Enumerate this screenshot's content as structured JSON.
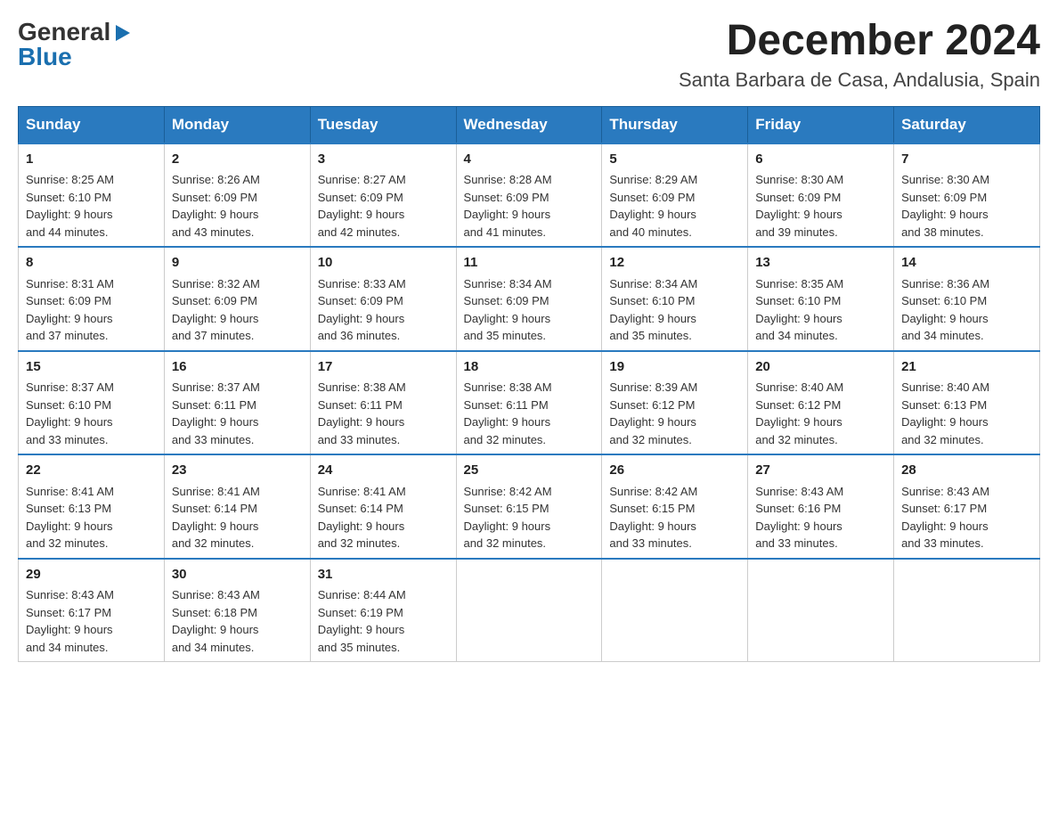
{
  "logo": {
    "general": "General",
    "blue": "Blue"
  },
  "header": {
    "month": "December 2024",
    "location": "Santa Barbara de Casa, Andalusia, Spain"
  },
  "weekdays": [
    "Sunday",
    "Monday",
    "Tuesday",
    "Wednesday",
    "Thursday",
    "Friday",
    "Saturday"
  ],
  "weeks": [
    [
      {
        "day": "1",
        "sunrise": "8:25 AM",
        "sunset": "6:10 PM",
        "daylight": "9 hours and 44 minutes."
      },
      {
        "day": "2",
        "sunrise": "8:26 AM",
        "sunset": "6:09 PM",
        "daylight": "9 hours and 43 minutes."
      },
      {
        "day": "3",
        "sunrise": "8:27 AM",
        "sunset": "6:09 PM",
        "daylight": "9 hours and 42 minutes."
      },
      {
        "day": "4",
        "sunrise": "8:28 AM",
        "sunset": "6:09 PM",
        "daylight": "9 hours and 41 minutes."
      },
      {
        "day": "5",
        "sunrise": "8:29 AM",
        "sunset": "6:09 PM",
        "daylight": "9 hours and 40 minutes."
      },
      {
        "day": "6",
        "sunrise": "8:30 AM",
        "sunset": "6:09 PM",
        "daylight": "9 hours and 39 minutes."
      },
      {
        "day": "7",
        "sunrise": "8:30 AM",
        "sunset": "6:09 PM",
        "daylight": "9 hours and 38 minutes."
      }
    ],
    [
      {
        "day": "8",
        "sunrise": "8:31 AM",
        "sunset": "6:09 PM",
        "daylight": "9 hours and 37 minutes."
      },
      {
        "day": "9",
        "sunrise": "8:32 AM",
        "sunset": "6:09 PM",
        "daylight": "9 hours and 37 minutes."
      },
      {
        "day": "10",
        "sunrise": "8:33 AM",
        "sunset": "6:09 PM",
        "daylight": "9 hours and 36 minutes."
      },
      {
        "day": "11",
        "sunrise": "8:34 AM",
        "sunset": "6:09 PM",
        "daylight": "9 hours and 35 minutes."
      },
      {
        "day": "12",
        "sunrise": "8:34 AM",
        "sunset": "6:10 PM",
        "daylight": "9 hours and 35 minutes."
      },
      {
        "day": "13",
        "sunrise": "8:35 AM",
        "sunset": "6:10 PM",
        "daylight": "9 hours and 34 minutes."
      },
      {
        "day": "14",
        "sunrise": "8:36 AM",
        "sunset": "6:10 PM",
        "daylight": "9 hours and 34 minutes."
      }
    ],
    [
      {
        "day": "15",
        "sunrise": "8:37 AM",
        "sunset": "6:10 PM",
        "daylight": "9 hours and 33 minutes."
      },
      {
        "day": "16",
        "sunrise": "8:37 AM",
        "sunset": "6:11 PM",
        "daylight": "9 hours and 33 minutes."
      },
      {
        "day": "17",
        "sunrise": "8:38 AM",
        "sunset": "6:11 PM",
        "daylight": "9 hours and 33 minutes."
      },
      {
        "day": "18",
        "sunrise": "8:38 AM",
        "sunset": "6:11 PM",
        "daylight": "9 hours and 32 minutes."
      },
      {
        "day": "19",
        "sunrise": "8:39 AM",
        "sunset": "6:12 PM",
        "daylight": "9 hours and 32 minutes."
      },
      {
        "day": "20",
        "sunrise": "8:40 AM",
        "sunset": "6:12 PM",
        "daylight": "9 hours and 32 minutes."
      },
      {
        "day": "21",
        "sunrise": "8:40 AM",
        "sunset": "6:13 PM",
        "daylight": "9 hours and 32 minutes."
      }
    ],
    [
      {
        "day": "22",
        "sunrise": "8:41 AM",
        "sunset": "6:13 PM",
        "daylight": "9 hours and 32 minutes."
      },
      {
        "day": "23",
        "sunrise": "8:41 AM",
        "sunset": "6:14 PM",
        "daylight": "9 hours and 32 minutes."
      },
      {
        "day": "24",
        "sunrise": "8:41 AM",
        "sunset": "6:14 PM",
        "daylight": "9 hours and 32 minutes."
      },
      {
        "day": "25",
        "sunrise": "8:42 AM",
        "sunset": "6:15 PM",
        "daylight": "9 hours and 32 minutes."
      },
      {
        "day": "26",
        "sunrise": "8:42 AM",
        "sunset": "6:15 PM",
        "daylight": "9 hours and 33 minutes."
      },
      {
        "day": "27",
        "sunrise": "8:43 AM",
        "sunset": "6:16 PM",
        "daylight": "9 hours and 33 minutes."
      },
      {
        "day": "28",
        "sunrise": "8:43 AM",
        "sunset": "6:17 PM",
        "daylight": "9 hours and 33 minutes."
      }
    ],
    [
      {
        "day": "29",
        "sunrise": "8:43 AM",
        "sunset": "6:17 PM",
        "daylight": "9 hours and 34 minutes."
      },
      {
        "day": "30",
        "sunrise": "8:43 AM",
        "sunset": "6:18 PM",
        "daylight": "9 hours and 34 minutes."
      },
      {
        "day": "31",
        "sunrise": "8:44 AM",
        "sunset": "6:19 PM",
        "daylight": "9 hours and 35 minutes."
      },
      null,
      null,
      null,
      null
    ]
  ],
  "labels": {
    "sunrise": "Sunrise:",
    "sunset": "Sunset:",
    "daylight": "Daylight:"
  }
}
